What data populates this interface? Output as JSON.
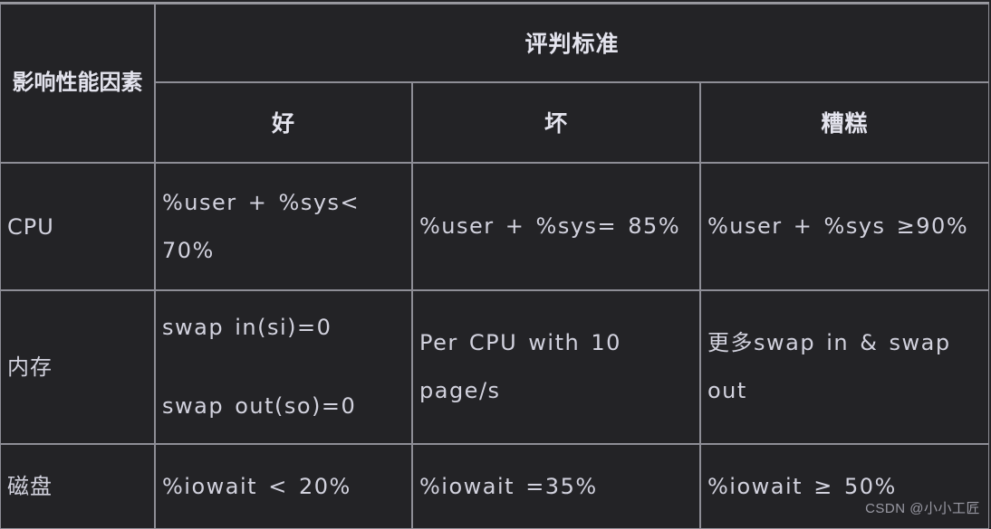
{
  "table": {
    "header": {
      "factor_column_label": "影响性能因素",
      "criteria_group_label": "评判标准",
      "sub_headers": [
        "好",
        "坏",
        "糟糕"
      ]
    },
    "rows": [
      {
        "factor": "CPU",
        "good": "%user + %sys< 70%",
        "bad": "%user + %sys= 85%",
        "awful": "%user + %sys ≥90%"
      },
      {
        "factor": "内存",
        "good_line1": "swap in(si)=0",
        "good_line2": "swap out(so)=0",
        "bad": "Per CPU with 10 page/s",
        "awful": "更多swap in & swap out"
      },
      {
        "factor": "磁盘",
        "good": "%iowait < 20%",
        "bad": "%iowait =35%",
        "awful": "%iowait ≥ 50%"
      }
    ]
  },
  "watermark": {
    "text": "CSDN @小小工匠"
  },
  "colors": {
    "background": "#232326",
    "border": "#8e8e96",
    "text": "#d2d2de",
    "heading_text": "#e4e4ee",
    "watermark_text": "#9a9aa4"
  }
}
